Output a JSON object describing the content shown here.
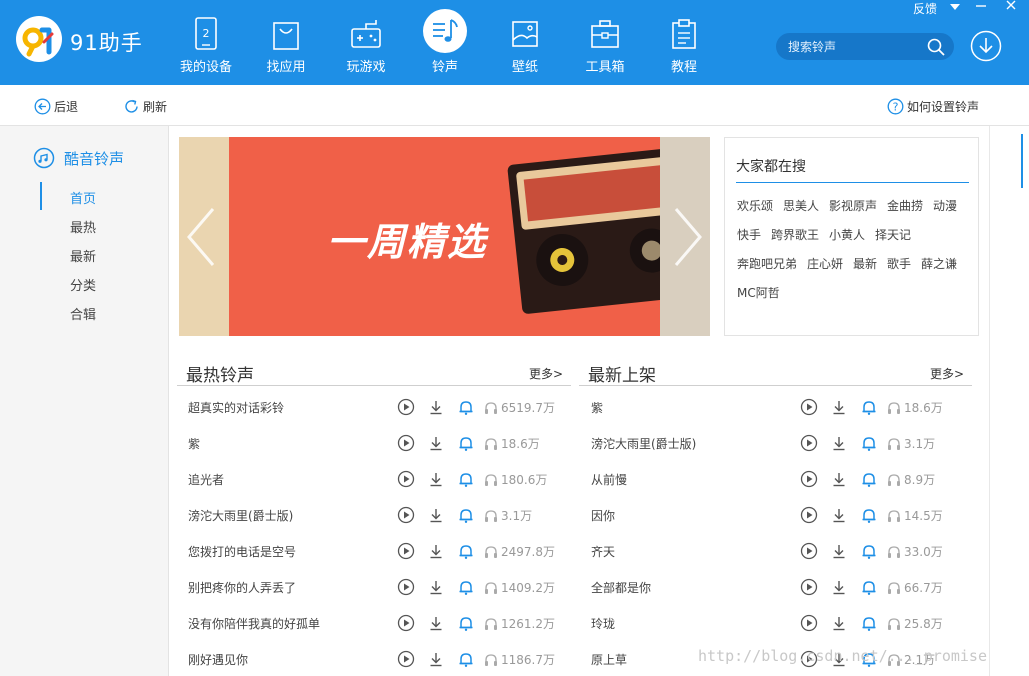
{
  "app": {
    "logo_text": "91助手"
  },
  "nav": [
    {
      "id": "device",
      "label": "我的设备",
      "icon": "phone-icon"
    },
    {
      "id": "apps",
      "label": "找应用",
      "icon": "shopping-bag-icon"
    },
    {
      "id": "games",
      "label": "玩游戏",
      "icon": "gamepad-icon"
    },
    {
      "id": "ringtone",
      "label": "铃声",
      "icon": "music-note-icon",
      "active": true
    },
    {
      "id": "wallpaper",
      "label": "壁纸",
      "icon": "picture-icon"
    },
    {
      "id": "toolbox",
      "label": "工具箱",
      "icon": "toolbox-icon"
    },
    {
      "id": "tutorial",
      "label": "教程",
      "icon": "clipboard-icon"
    }
  ],
  "window": {
    "feedback": "反馈"
  },
  "search": {
    "placeholder": "搜索铃声"
  },
  "toolbar": {
    "back": "后退",
    "refresh": "刷新",
    "help": "如何设置铃声"
  },
  "sidebar": {
    "title": "酷音铃声",
    "items": [
      "首页",
      "最热",
      "最新",
      "分类",
      "合辑"
    ]
  },
  "banner": {
    "title": "一周精选"
  },
  "hot_search": {
    "title": "大家都在搜",
    "rows": [
      [
        "欢乐颂",
        "思美人",
        "影视原声",
        "金曲捞",
        "动漫"
      ],
      [
        "快手",
        "跨界歌王",
        "小黄人",
        "择天记"
      ],
      [
        "奔跑吧兄弟",
        "庄心妍",
        "最新",
        "歌手",
        "薛之谦"
      ],
      [
        "MC阿哲"
      ]
    ]
  },
  "hot_list": {
    "title": "最热铃声",
    "more": "更多>",
    "items": [
      {
        "name": "超真实的对话彩铃",
        "count": "6519.7万"
      },
      {
        "name": "紫",
        "count": "18.6万"
      },
      {
        "name": "追光者",
        "count": "180.6万"
      },
      {
        "name": "滂沱大雨里(爵士版)",
        "count": "3.1万"
      },
      {
        "name": "您拨打的电话是空号",
        "count": "2497.8万"
      },
      {
        "name": "别把疼你的人弄丢了",
        "count": "1409.2万"
      },
      {
        "name": "没有你陪伴我真的好孤单",
        "count": "1261.2万"
      },
      {
        "name": "刚好遇见你",
        "count": "1186.7万"
      }
    ]
  },
  "new_list": {
    "title": "最新上架",
    "more": "更多>",
    "items": [
      {
        "name": "紫",
        "count": "18.6万"
      },
      {
        "name": "滂沱大雨里(爵士版)",
        "count": "3.1万"
      },
      {
        "name": "从前慢",
        "count": "8.9万"
      },
      {
        "name": "因你",
        "count": "14.5万"
      },
      {
        "name": "齐天",
        "count": "33.0万"
      },
      {
        "name": "全部都是你",
        "count": "66.7万"
      },
      {
        "name": "玲珑",
        "count": "25.8万"
      },
      {
        "name": "原上草",
        "count": "2.1万"
      }
    ]
  },
  "watermark": "http://blog.csdn.net/..._promise",
  "colors": {
    "brand_blue": "#1e8fe6",
    "banner_red": "#f06048"
  }
}
